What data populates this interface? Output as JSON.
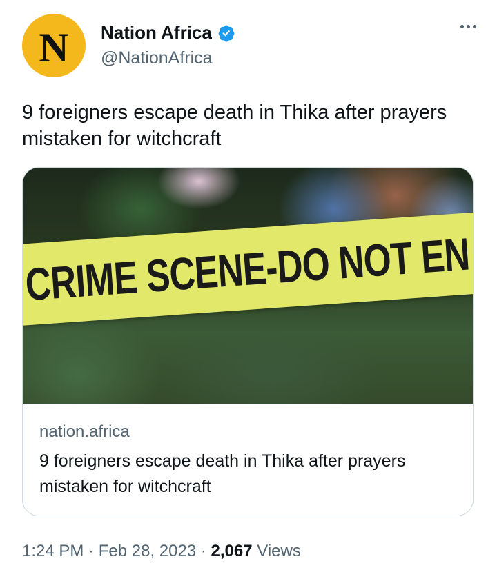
{
  "author": {
    "avatar_letter": "N",
    "name": "Nation Africa",
    "handle": "@NationAfrica",
    "verified": true
  },
  "tweet": {
    "text": "9 foreigners escape death in Thika after prayers mistaken for witchcraft"
  },
  "card": {
    "image_text": "CRIME SCENE-DO NOT EN",
    "domain": "nation.africa",
    "title": "9 foreigners escape death in Thika after prayers mistaken for witchcraft"
  },
  "meta": {
    "time": "1:24 PM",
    "separator": "·",
    "date": "Feb 28, 2023",
    "views_count": "2,067",
    "views_label": "Views"
  },
  "colors": {
    "avatar_bg": "#f5b81c",
    "verified": "#1d9bf0",
    "muted_text": "#536471"
  }
}
